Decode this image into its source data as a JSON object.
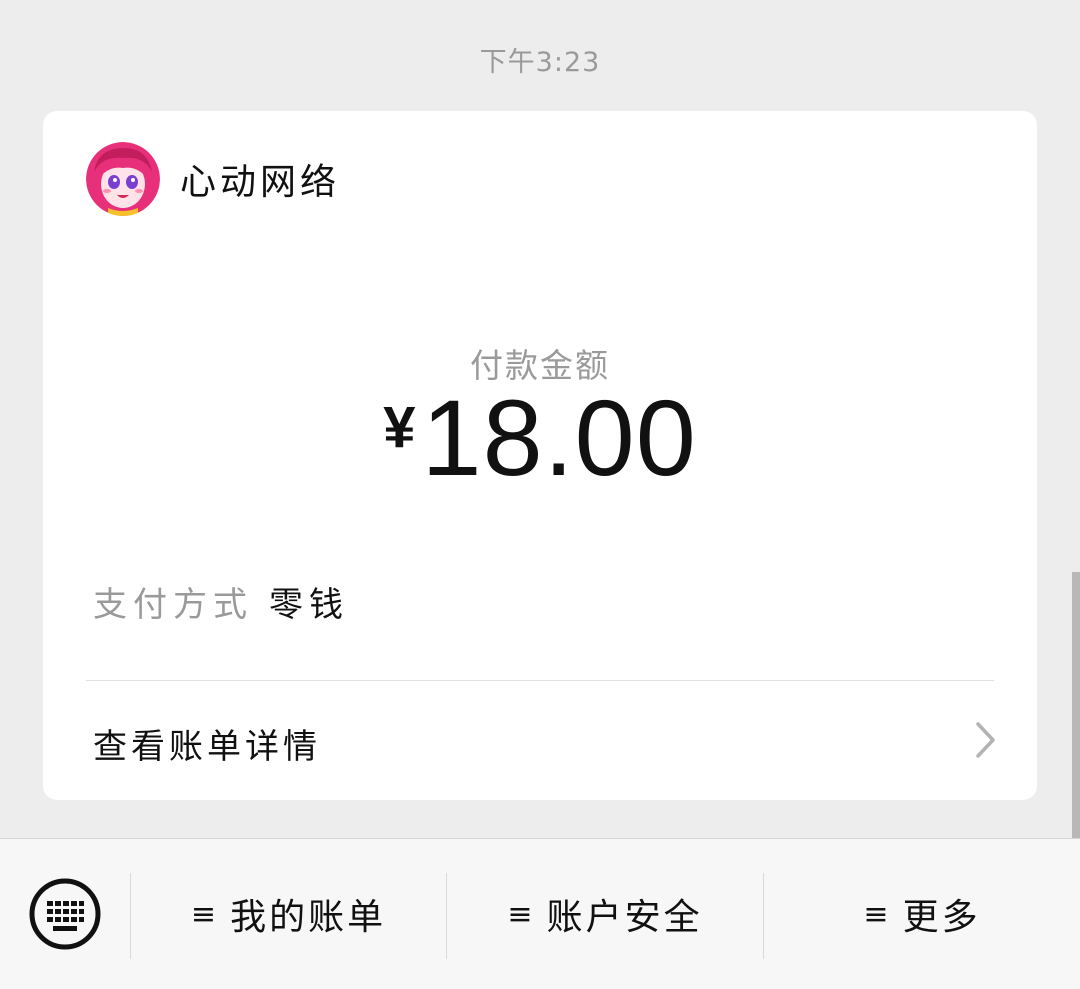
{
  "timestamp": "下午3:23",
  "payment_card": {
    "merchant_name": "心动网络",
    "amount_label": "付款金额",
    "currency_symbol": "¥",
    "amount_value": "18.00",
    "method_label": "支付方式",
    "method_value": "零钱",
    "details_label": "查看账单详情"
  },
  "bottom_menu": {
    "keyboard_icon": "keyboard-icon",
    "items": [
      {
        "icon": "≡",
        "label": "我的账单"
      },
      {
        "icon": "≡",
        "label": "账户安全"
      },
      {
        "icon": "≡",
        "label": "更多"
      }
    ]
  },
  "colors": {
    "background": "#ededed",
    "card": "#ffffff",
    "muted_text": "#9a9a9a",
    "primary_text": "#111111",
    "avatar_accent": "#e8307a"
  }
}
